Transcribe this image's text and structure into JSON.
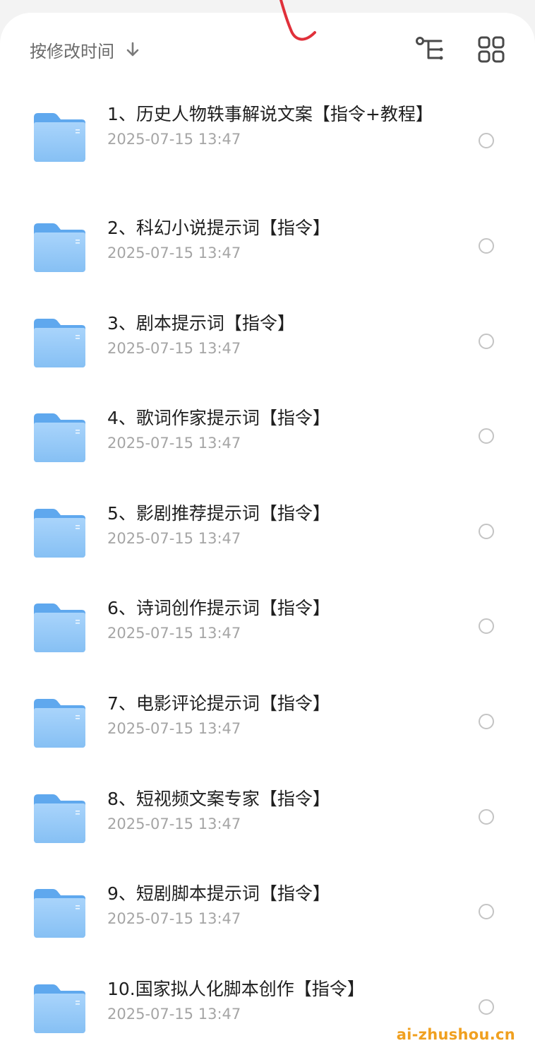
{
  "toolbar": {
    "sort_label": "按修改时间",
    "sort_direction_icon": "arrow-down-icon",
    "tree_view_icon": "tree-structure-icon",
    "grid_view_icon": "grid-view-icon"
  },
  "files": [
    {
      "name": "1、历史人物轶事解说文案【指令+教程】",
      "modified": "2025-07-15 13:47"
    },
    {
      "name": "2、科幻小说提示词【指令】",
      "modified": "2025-07-15 13:47"
    },
    {
      "name": "3、剧本提示词【指令】",
      "modified": "2025-07-15 13:47"
    },
    {
      "name": "4、歌词作家提示词【指令】",
      "modified": "2025-07-15 13:47"
    },
    {
      "name": "5、影剧推荐提示词【指令】",
      "modified": "2025-07-15 13:47"
    },
    {
      "name": "6、诗词创作提示词【指令】",
      "modified": "2025-07-15 13:47"
    },
    {
      "name": "7、电影评论提示词【指令】",
      "modified": "2025-07-15 13:47"
    },
    {
      "name": "8、短视频文案专家【指令】",
      "modified": "2025-07-15 13:47"
    },
    {
      "name": "9、短剧脚本提示词【指令】",
      "modified": "2025-07-15 13:47"
    },
    {
      "name": "10.国家拟人化脚本创作【指令】",
      "modified": "2025-07-15 13:47"
    }
  ],
  "watermark": "ai-zhushou.cn",
  "colors": {
    "folder_blue": "#79b9f2",
    "watermark_orange": "#f0a020",
    "annotation_red": "#e0303a"
  }
}
